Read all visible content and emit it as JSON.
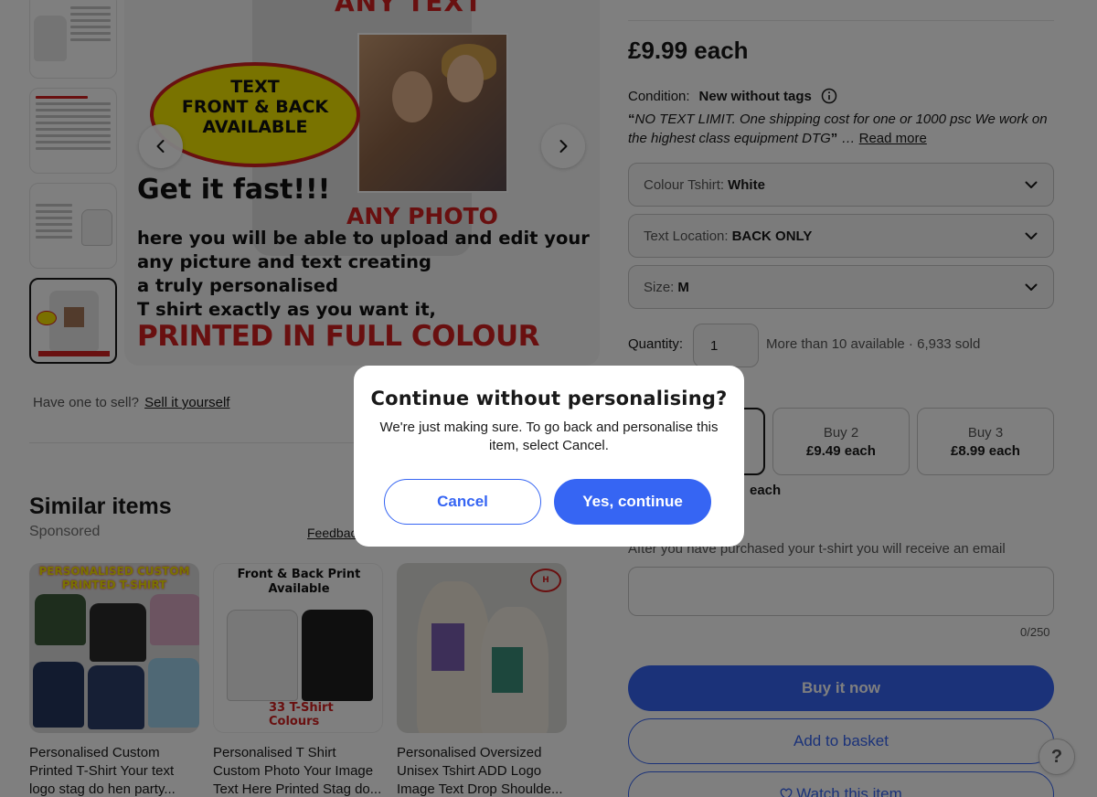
{
  "gallery": {
    "promo": {
      "any_text": "ANY TEXT",
      "badge_lines": [
        "TEXT",
        "FRONT & BACK",
        "AVAILABLE"
      ],
      "get_it_fast": "Get it fast!!!",
      "any_photo": "ANY PHOTO",
      "lines": [
        "here you will be able to upload and edit your",
        "any picture and text creating",
        "a truly personalised",
        "T shirt exactly as you want it,"
      ],
      "printed_full": "PRINTED IN FULL COLOUR"
    }
  },
  "sell": {
    "prompt": "Have one to sell?",
    "link": "Sell it yourself"
  },
  "similar": {
    "title": "Similar items",
    "sponsored": "Sponsored",
    "feedback": "Feedback",
    "cards": [
      {
        "title": "Personalised Custom Printed T-Shirt Your text logo stag do hen party...",
        "image_header": "PERSONALISED CUSTOM PRINTED T-SHIRT"
      },
      {
        "title": "Personalised T Shirt Custom Photo Your Image Text Here Printed Stag do...",
        "image_header": "Front & Back Print Available",
        "image_footer": "33 T-Shirt Colours"
      },
      {
        "title": "Personalised Oversized Unisex Tshirt ADD Logo Image Text Drop Shoulde..."
      }
    ]
  },
  "listing": {
    "price": "£9.99 each",
    "condition_label": "Condition:",
    "condition_value": "New without tags",
    "description": "NO TEXT LIMIT. One shipping cost for one or 1000 psc We work on the highest class equipment DTG",
    "read_more": "Read more",
    "options": [
      {
        "label": "Colour Tshirt:",
        "value": "White"
      },
      {
        "label": "Text Location:",
        "value": "BACK ONLY"
      },
      {
        "label": "Size:",
        "value": "M"
      }
    ],
    "quantity_label": "Quantity:",
    "quantity_value": "1",
    "availability": "More than 10 available · 6,933 sold",
    "bulk": [
      {
        "label": "Buy 2",
        "price": "£9.49 each"
      },
      {
        "label": "Buy 3",
        "price": "£8.99 each"
      }
    ],
    "each_fragment": "each",
    "email_note": "After you have purchased your t-shirt you will receive an email",
    "char_counter": "0/250",
    "buy_now": "Buy it now",
    "add_to_basket": "Add to basket",
    "watch": "Watch this item",
    "help": "?"
  },
  "dialog": {
    "title": "Continue without personalising?",
    "body": "We're just making sure. To go back and personalise this item, select Cancel.",
    "cancel": "Cancel",
    "confirm": "Yes, continue"
  },
  "colors": {
    "accent": "#3665f3",
    "promo_red": "#d32020",
    "badge_yellow": "#f2e600"
  }
}
